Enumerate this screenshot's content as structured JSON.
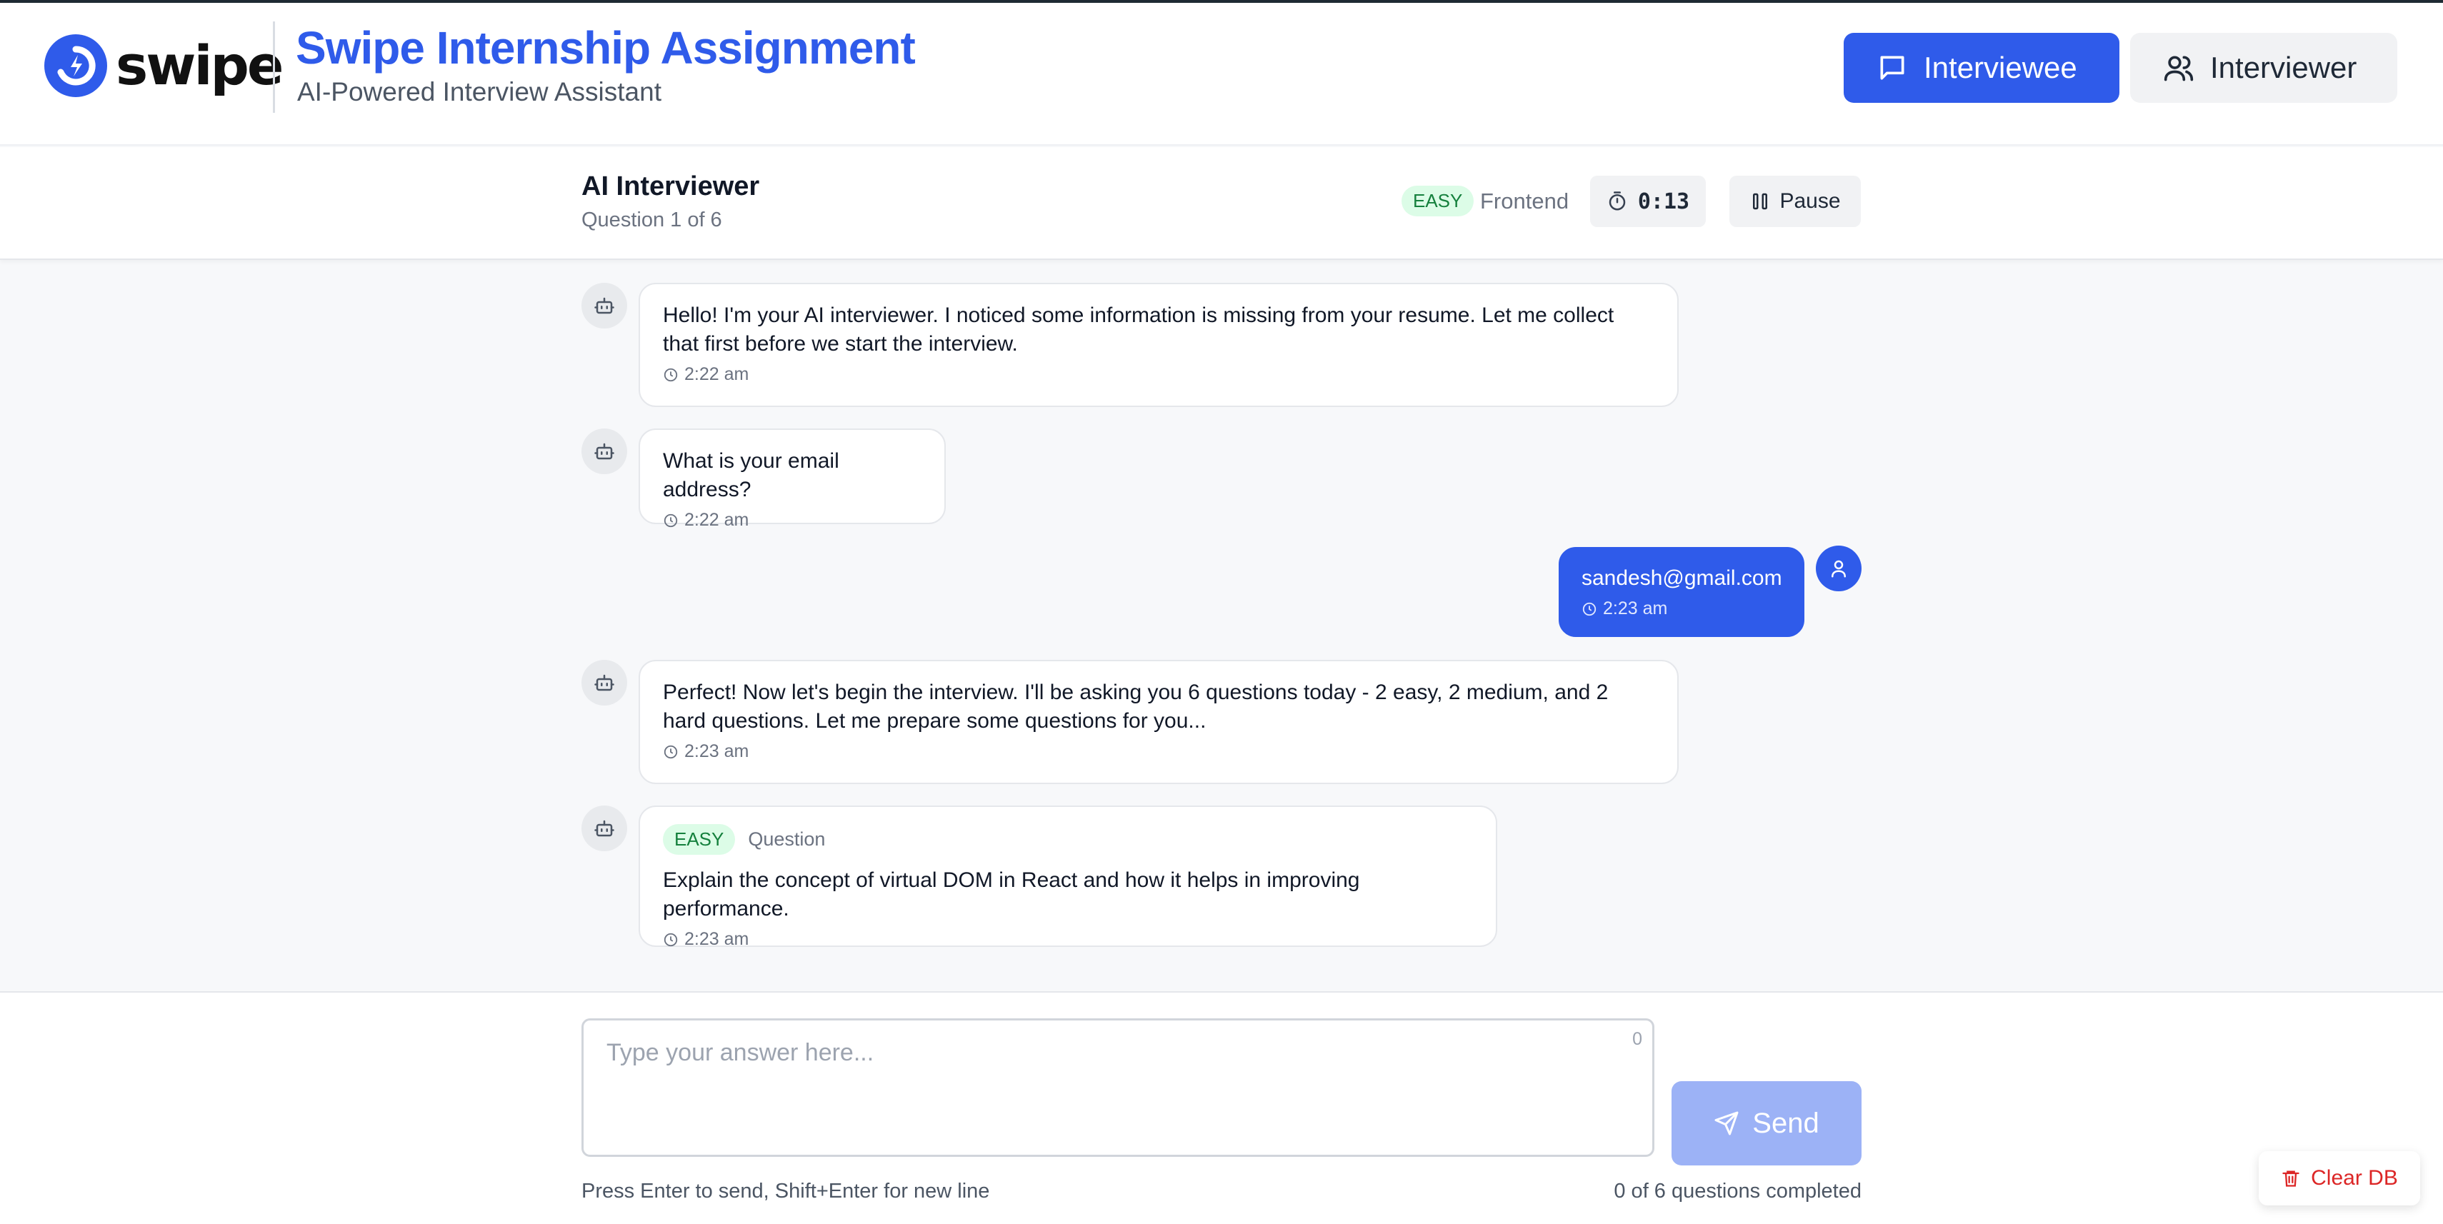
{
  "header": {
    "logo_text": "swipe",
    "title": "Swipe Internship Assignment",
    "subtitle": "AI-Powered Interview Assistant",
    "interviewee_label": "Interviewee",
    "interviewer_label": "Interviewer"
  },
  "session": {
    "title": "AI Interviewer",
    "progress": "Question 1 of 6",
    "difficulty": "EASY",
    "topic": "Frontend",
    "timer": "0:13",
    "pause_label": "Pause"
  },
  "messages": [
    {
      "sender": "ai",
      "text": "Hello! I'm your AI interviewer. I noticed some information is missing from your resume. Let me collect that first before we start the interview.",
      "time": "2:22 am"
    },
    {
      "sender": "ai",
      "text": "What is your email address?",
      "time": "2:22 am"
    },
    {
      "sender": "user",
      "text": "sandesh@gmail.com",
      "time": "2:23 am"
    },
    {
      "sender": "ai",
      "text": "Perfect! Now let's begin the interview. I'll be asking you 6 questions today - 2 easy, 2 medium, and 2 hard questions. Let me prepare some questions for you...",
      "time": "2:23 am"
    },
    {
      "sender": "ai",
      "difficulty": "EASY",
      "label": "Question",
      "text": "Explain the concept of virtual DOM in React and how it helps in improving performance.",
      "time": "2:23 am"
    }
  ],
  "composer": {
    "placeholder": "Type your answer here...",
    "char_count": "0",
    "send_label": "Send",
    "hint": "Press Enter to send, Shift+Enter for new line",
    "completed": "0 of 6 questions completed"
  },
  "clear_db_label": "Clear DB",
  "colors": {
    "brand": "#2f5bea",
    "easy_bg": "#dcfce7",
    "easy_text": "#15803d",
    "danger": "#dc2626",
    "send_disabled": "#9cb2f6"
  }
}
